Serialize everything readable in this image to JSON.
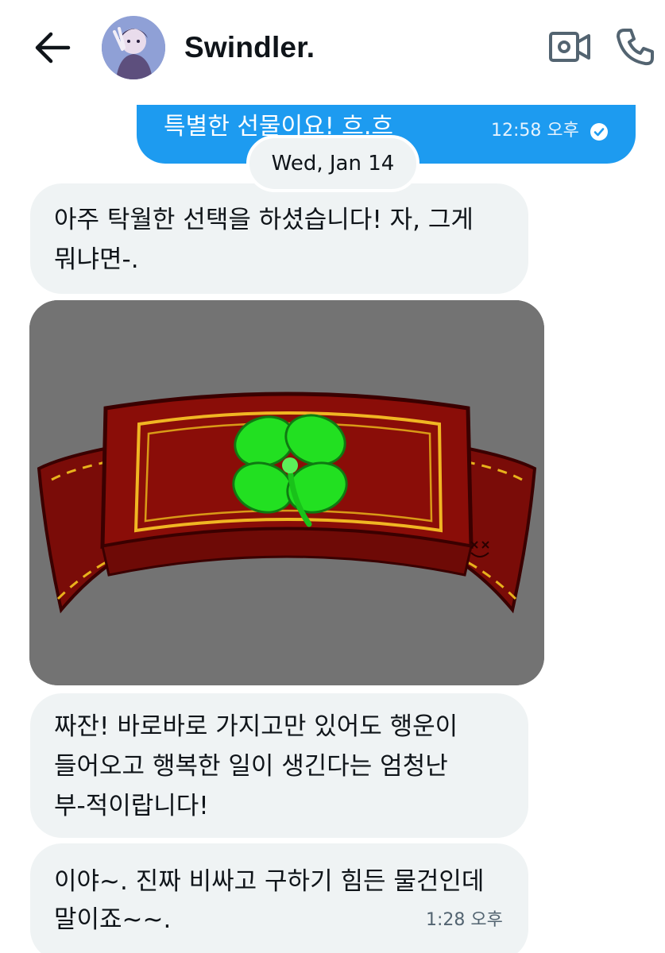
{
  "header": {
    "contact_name": "Swindler."
  },
  "messages": {
    "sent": {
      "text": "특별한 선물이요! 흐.흐",
      "time": "12:58 오후",
      "status_icon": "read-check-icon"
    },
    "date_divider": "Wed, Jan 14",
    "received": [
      {
        "lines": [
          "아주 탁월한 선택을 하셨습니다! 자, 그게",
          "뭐냐면-."
        ]
      },
      {
        "image": "red-ribbon-headband-with-green-four-leaf-clover-drawing"
      },
      {
        "lines": [
          "짜잔! 바로바로 가지고만 있어도 행운이",
          "들어오고 행복한 일이 생긴다는 엄청난",
          "부-적이랍니다!"
        ]
      },
      {
        "lines": [
          "이야~. 진짜 비싸고 구하기 힘든 물건인데",
          "말이죠~~."
        ],
        "time": "1:28 오후"
      }
    ]
  },
  "colors": {
    "sent_bubble": "#1d9bf0",
    "received_bubble": "#eff3f4",
    "text_primary": "#0f1419",
    "text_secondary": "#536471",
    "icon_gray": "#536471"
  }
}
